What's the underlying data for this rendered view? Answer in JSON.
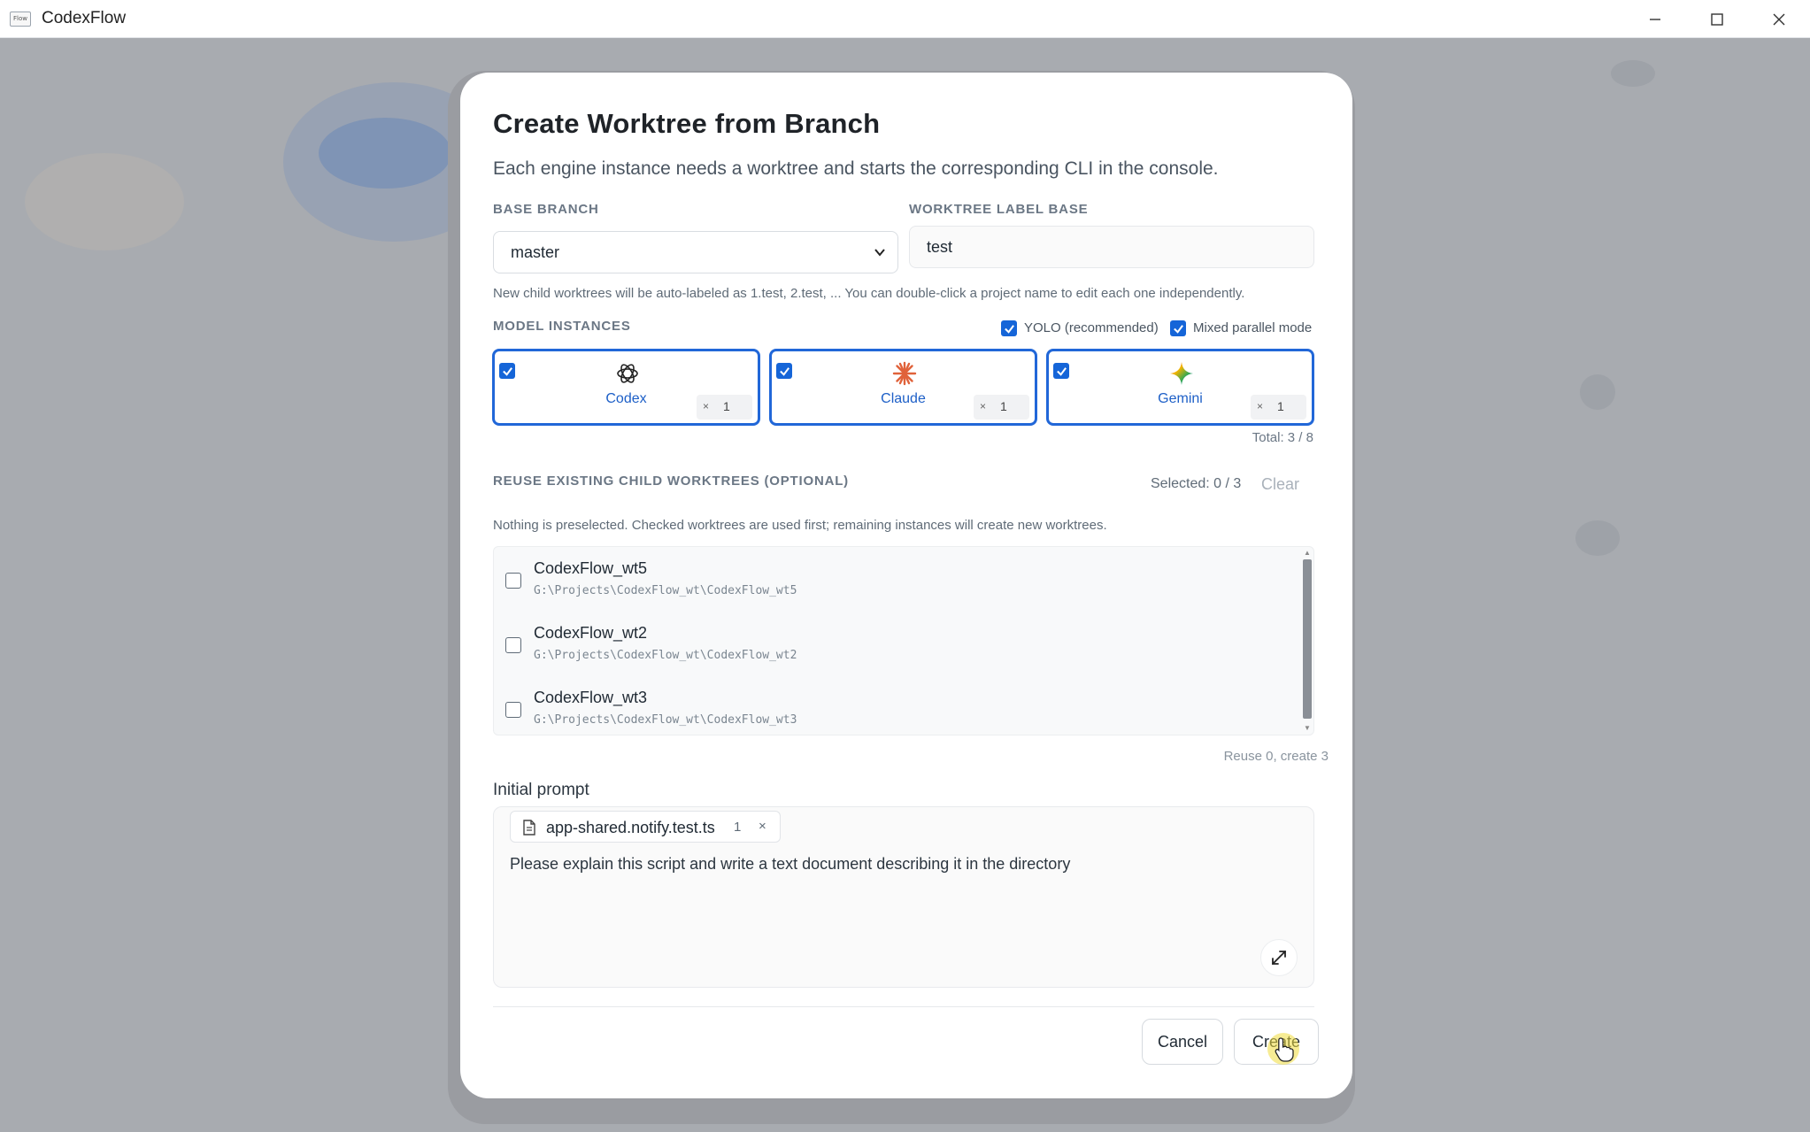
{
  "window": {
    "title": "CodexFlow",
    "logo_text": "Flow"
  },
  "dialog": {
    "title": "Create Worktree from Branch",
    "subtitle": "Each engine instance needs a worktree and starts the corresponding CLI in the console.",
    "base_branch": {
      "label": "BASE BRANCH",
      "value": "master"
    },
    "worktree_label_base": {
      "label": "WORKTREE LABEL BASE",
      "value": "test"
    },
    "label_hint": "New child worktrees will be auto-labeled as 1.test, 2.test, ... You can double-click a project name to edit each one independently.",
    "model_instances": {
      "label": "MODEL INSTANCES",
      "yolo_label": "YOLO (recommended)",
      "yolo_checked": true,
      "mixed_label": "Mixed parallel mode",
      "mixed_checked": true,
      "engines": [
        {
          "name": "Codex",
          "checked": true,
          "multiplier": "×",
          "count": "1",
          "icon": "openai-icon"
        },
        {
          "name": "Claude",
          "checked": true,
          "multiplier": "×",
          "count": "1",
          "icon": "claude-icon"
        },
        {
          "name": "Gemini",
          "checked": true,
          "multiplier": "×",
          "count": "1",
          "icon": "gemini-icon"
        }
      ],
      "total": "Total: 3 / 8"
    },
    "reuse": {
      "label": "REUSE EXISTING CHILD WORKTREES (OPTIONAL)",
      "selected": "Selected: 0 / 3",
      "clear_label": "Clear",
      "hint": "Nothing is preselected. Checked worktrees are used first; remaining instances will create new worktrees.",
      "items": [
        {
          "name": "CodexFlow_wt5",
          "path": "G:\\Projects\\CodexFlow_wt\\CodexFlow_wt5",
          "checked": false
        },
        {
          "name": "CodexFlow_wt2",
          "path": "G:\\Projects\\CodexFlow_wt\\CodexFlow_wt2",
          "checked": false
        },
        {
          "name": "CodexFlow_wt3",
          "path": "G:\\Projects\\CodexFlow_wt\\CodexFlow_wt3",
          "checked": false
        }
      ],
      "summary": "Reuse 0, create 3"
    },
    "prompt": {
      "label": "Initial prompt",
      "file_chip": {
        "name": "app-shared.notify.test.ts",
        "count": "1",
        "close": "×"
      },
      "text": "Please explain this script and write a text document describing it in the directory"
    },
    "buttons": {
      "cancel": "Cancel",
      "create": "Create"
    }
  },
  "colors": {
    "accent": "#2167d8",
    "engine_text": "#1d5fc7",
    "backdrop": "#a8abb0"
  }
}
